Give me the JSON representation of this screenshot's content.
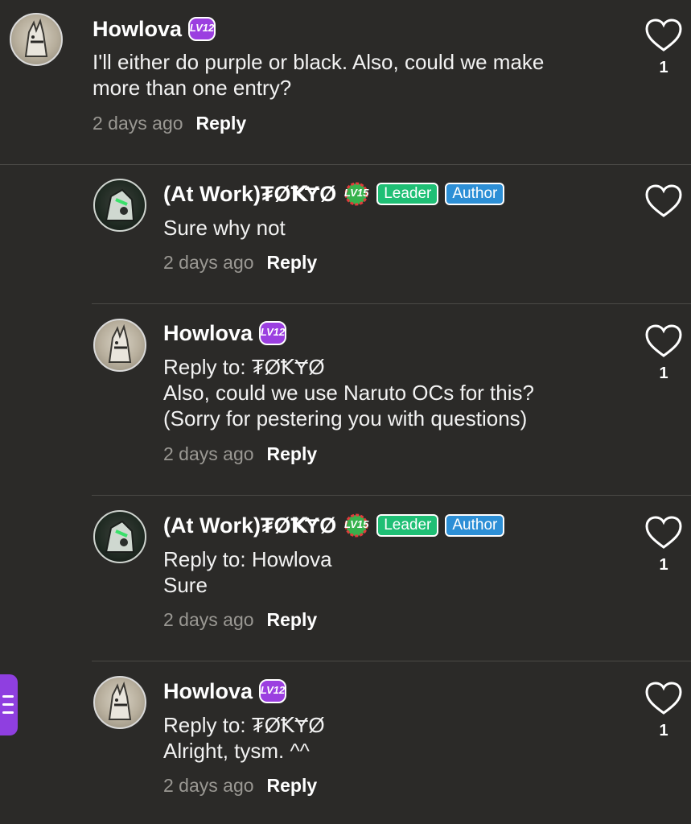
{
  "comments": [
    {
      "author": "Howlova",
      "level": "LV12",
      "lines": [
        "I'll either do purple or black. Also, could we make",
        "more than one entry?"
      ],
      "time": "2 days ago",
      "reply_label": "Reply",
      "likes": "1"
    },
    {
      "author": "(At Work)₮ØꝀɎØ",
      "level": "LV15",
      "badges": [
        "Leader",
        "Author"
      ],
      "lines": [
        "Sure why not"
      ],
      "time": "2 days ago",
      "reply_label": "Reply",
      "likes": ""
    },
    {
      "author": "Howlova",
      "level": "LV12",
      "lines": [
        "Reply to: ₮ØꝀɎØ",
        "Also, could we use Naruto OCs for this?",
        "(Sorry for pestering you with questions)"
      ],
      "time": "2 days ago",
      "reply_label": "Reply",
      "likes": "1"
    },
    {
      "author": "(At Work)₮ØꝀɎØ",
      "level": "LV15",
      "badges": [
        "Leader",
        "Author"
      ],
      "lines": [
        "Reply to: Howlova",
        "Sure"
      ],
      "time": "2 days ago",
      "reply_label": "Reply",
      "likes": "1"
    },
    {
      "author": "Howlova",
      "level": "LV12",
      "lines": [
        "Reply to: ₮ØꝀɎØ",
        "Alright, tysm. ^^"
      ],
      "time": "2 days ago",
      "reply_label": "Reply",
      "likes": "1"
    }
  ],
  "icons": {
    "like": "heart-outline-icon",
    "level_badge": "level-badge-icon",
    "side_menu": "menu-icon"
  },
  "colors": {
    "background": "#2b2a28",
    "leader_badge": "#1fbf75",
    "author_badge": "#2d8fd6",
    "level12_badge": "#9b3fe0",
    "level15_badge": "#37b24d",
    "side_tab": "#8f3fe0"
  }
}
